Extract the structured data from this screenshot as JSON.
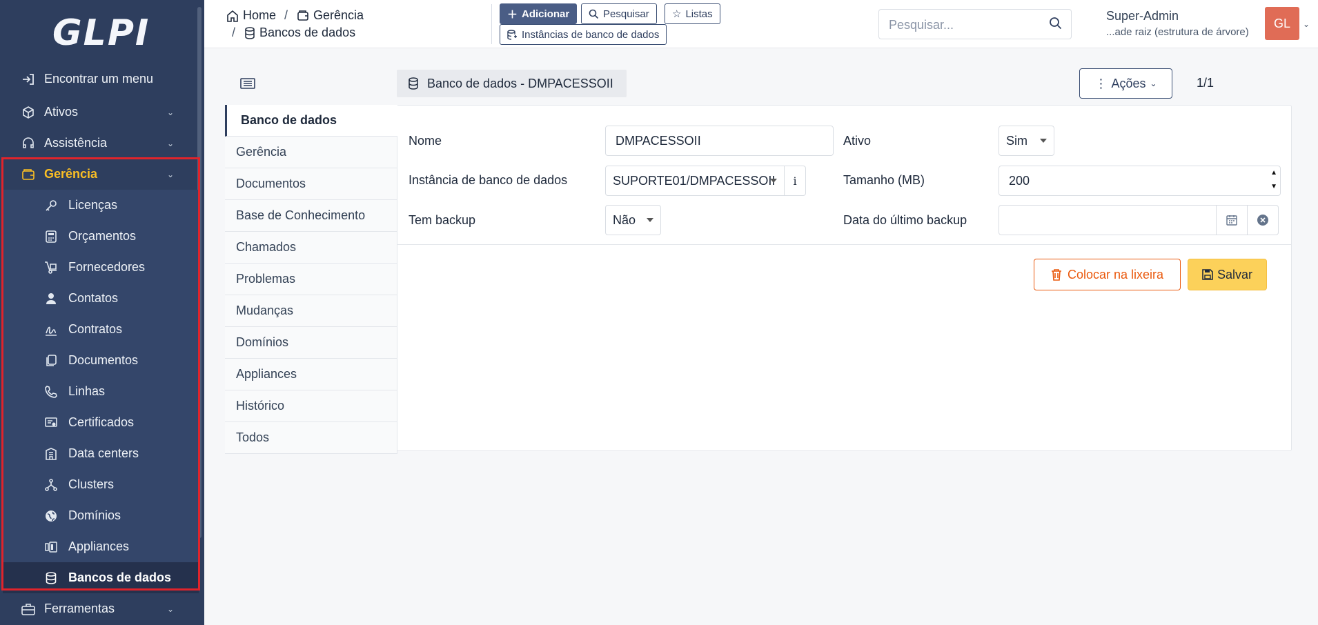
{
  "app": {
    "logo_text": "GLPI"
  },
  "sidebar": {
    "find_menu": "Encontrar um menu",
    "sections": [
      {
        "label": "Ativos"
      },
      {
        "label": "Assistência"
      },
      {
        "label": "Gerência"
      }
    ],
    "gerencia_items": [
      {
        "label": "Licenças",
        "icon": "key-icon"
      },
      {
        "label": "Orçamentos",
        "icon": "calculator-icon"
      },
      {
        "label": "Fornecedores",
        "icon": "dolly-icon"
      },
      {
        "label": "Contatos",
        "icon": "user-icon"
      },
      {
        "label": "Contratos",
        "icon": "signature-icon"
      },
      {
        "label": "Documentos",
        "icon": "files-icon"
      },
      {
        "label": "Linhas",
        "icon": "phone-icon"
      },
      {
        "label": "Certificados",
        "icon": "certificate-icon"
      },
      {
        "label": "Data centers",
        "icon": "building-icon"
      },
      {
        "label": "Clusters",
        "icon": "sitemap-icon"
      },
      {
        "label": "Domínios",
        "icon": "globe-icon"
      },
      {
        "label": "Appliances",
        "icon": "cubes-icon"
      },
      {
        "label": "Bancos de dados",
        "icon": "database-icon"
      }
    ],
    "ferramentas": "Ferramentas"
  },
  "header": {
    "breadcrumb": {
      "home": "Home",
      "sep1": "/",
      "gerencia": "Gerência",
      "sep2": "/",
      "bancos": "Bancos de dados"
    },
    "buttons": {
      "add": "Adicionar",
      "search": "Pesquisar",
      "lists": "Listas",
      "instances": "Instâncias de banco de dados"
    },
    "search_placeholder": "Pesquisar...",
    "user": {
      "name": "Super-Admin",
      "entity": "...ade raiz (estrutura de árvore)",
      "initials": "GL"
    }
  },
  "item": {
    "title": "Banco de dados - DMPACESSOII",
    "actions": "Ações",
    "pager": "1/1"
  },
  "tabs": [
    "Banco de dados",
    "Gerência",
    "Documentos",
    "Base de Conhecimento",
    "Chamados",
    "Problemas",
    "Mudanças",
    "Domínios",
    "Appliances",
    "Histórico",
    "Todos"
  ],
  "form": {
    "nome_label": "Nome",
    "nome_value": "DMPACESSOII",
    "ativo_label": "Ativo",
    "ativo_value": "Sim",
    "instancia_label": "Instância de banco de dados",
    "instancia_value": "SUPORTE01/DMPACESSOII",
    "tamanho_label": "Tamanho (MB)",
    "tamanho_value": "200",
    "backup_label": "Tem backup",
    "backup_value": "Não",
    "data_backup_label": "Data do último backup",
    "data_backup_value": ""
  },
  "footer_buttons": {
    "trash": "Colocar na lixeira",
    "save": "Salvar"
  },
  "colors": {
    "sidebar": "#2e3e5e",
    "accent": "#fbbf24",
    "highlight_box": "#e0242b",
    "trash": "#ea580c",
    "save": "#fcd15a"
  }
}
